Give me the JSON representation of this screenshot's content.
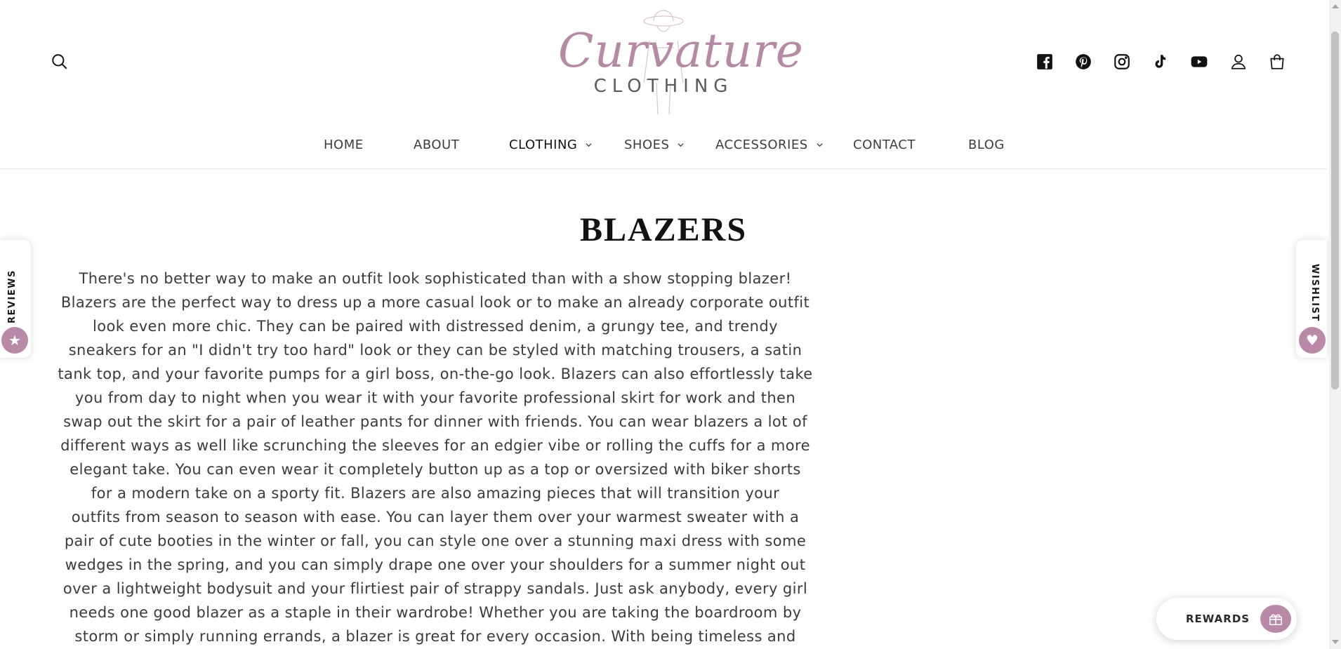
{
  "header": {
    "logo": {
      "script_text": "Curvature",
      "sub_text": "CLOTHING"
    },
    "icons": {
      "search": "search-icon",
      "social": [
        "facebook-icon",
        "pinterest-icon",
        "instagram-icon",
        "tiktok-icon",
        "youtube-icon"
      ],
      "account": "account-icon",
      "cart": "cart-icon"
    }
  },
  "nav": {
    "items": [
      {
        "label": "HOME",
        "has_dropdown": false
      },
      {
        "label": "ABOUT",
        "has_dropdown": false
      },
      {
        "label": "CLOTHING",
        "has_dropdown": true,
        "active": true
      },
      {
        "label": "SHOES",
        "has_dropdown": true
      },
      {
        "label": "ACCESSORIES",
        "has_dropdown": true
      },
      {
        "label": "CONTACT",
        "has_dropdown": false
      },
      {
        "label": "BLOG",
        "has_dropdown": false
      }
    ]
  },
  "main": {
    "title": "BLAZERS",
    "description_lines": [
      "There's no better way to make an outfit look sophisticated than with a show stopping blazer!",
      "Blazers are the perfect way to dress up a more casual look or to make an already corporate outfit",
      "look even more chic. They can be paired with distressed denim, a grungy tee, and trendy",
      "sneakers for an \"I didn't try too hard\" look or they can be styled with matching trousers, a satin",
      "tank top, and your favorite pumps for a girl boss, on-the-go look. Blazers can also effortlessly take",
      "you from day to night when you wear it with your favorite professional skirt for work and then",
      "swap out the skirt for a pair of leather pants for dinner with friends. You can wear blazers a lot of",
      "different ways as well like scrunching the sleeves for an edgier vibe or rolling the cuffs for a more",
      "elegant take. You can even wear it completely button up as a top or oversized with biker shorts",
      "for a modern take on a sporty fit. Blazers are also amazing pieces that will transition your",
      "outfits from season to season with ease. You can layer them over your warmest sweater with a",
      "pair of cute booties in the winter or fall, you can style one over a stunning maxi dress with some",
      "wedges in the spring, and you can simply drape one over your shoulders for a summer night out",
      "over a lightweight bodysuit and your flirtiest pair of strappy sandals. Just ask anybody, every girl",
      "needs one good blazer as a staple in their wardrobe! Whether you are taking the boardroom by",
      "storm or simply running errands, a blazer is great for every occasion. With being timeless and"
    ]
  },
  "widgets": {
    "reviews_label": "REVIEWS",
    "reviews_icon": "star-icon",
    "wishlist_label": "WISHLIST",
    "wishlist_icon": "heart-icon",
    "rewards_label": "REWARDS",
    "rewards_icon": "gift-icon"
  },
  "colors": {
    "accent": "#b98aa8",
    "text": "#3b3b3b"
  }
}
